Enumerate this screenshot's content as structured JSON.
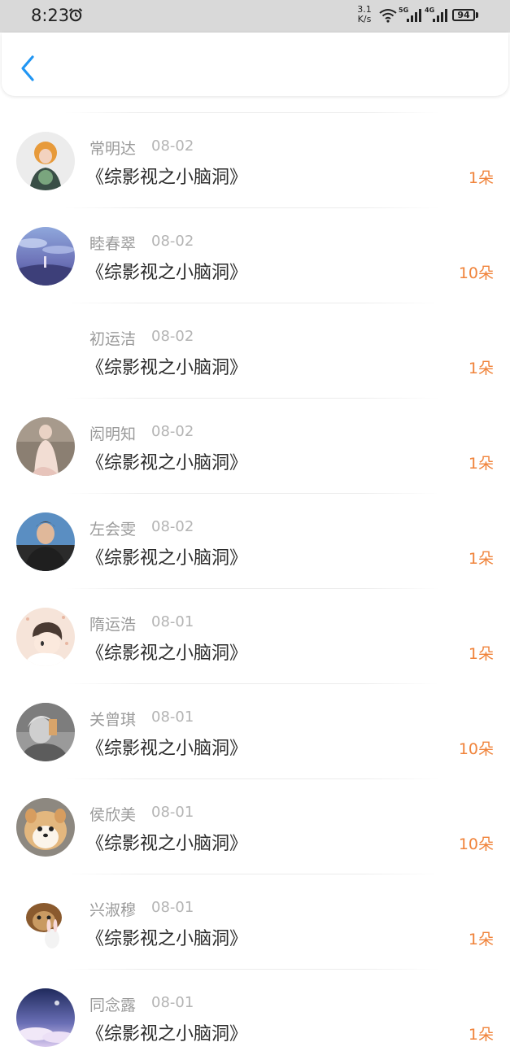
{
  "status_bar": {
    "time": "8:23",
    "net_speed_value": "3.1",
    "net_speed_unit": "K/s",
    "signal1_label": "5G",
    "signal2_label": "4G",
    "battery": "94"
  },
  "header": {
    "back_icon": "chevron-left-icon"
  },
  "colors": {
    "accent_back": "#2196f3",
    "count": "#f0833a"
  },
  "records": [
    {
      "name": "常明达",
      "date": "08-02",
      "title": "《综影视之小脑洞》",
      "count": "1朵"
    },
    {
      "name": "睦春翠",
      "date": "08-02",
      "title": "《综影视之小脑洞》",
      "count": "10朵"
    },
    {
      "name": "初运洁",
      "date": "08-02",
      "title": "《综影视之小脑洞》",
      "count": "1朵"
    },
    {
      "name": "闳明知",
      "date": "08-02",
      "title": "《综影视之小脑洞》",
      "count": "1朵"
    },
    {
      "name": "左会雯",
      "date": "08-02",
      "title": "《综影视之小脑洞》",
      "count": "1朵"
    },
    {
      "name": "隋运浩",
      "date": "08-01",
      "title": "《综影视之小脑洞》",
      "count": "1朵"
    },
    {
      "name": "关曾琪",
      "date": "08-01",
      "title": "《综影视之小脑洞》",
      "count": "10朵"
    },
    {
      "name": "侯欣美",
      "date": "08-01",
      "title": "《综影视之小脑洞》",
      "count": "10朵"
    },
    {
      "name": "兴淑穆",
      "date": "08-01",
      "title": "《综影视之小脑洞》",
      "count": "1朵"
    },
    {
      "name": "同念露",
      "date": "08-01",
      "title": "《综影视之小脑洞》",
      "count": "1朵"
    }
  ]
}
